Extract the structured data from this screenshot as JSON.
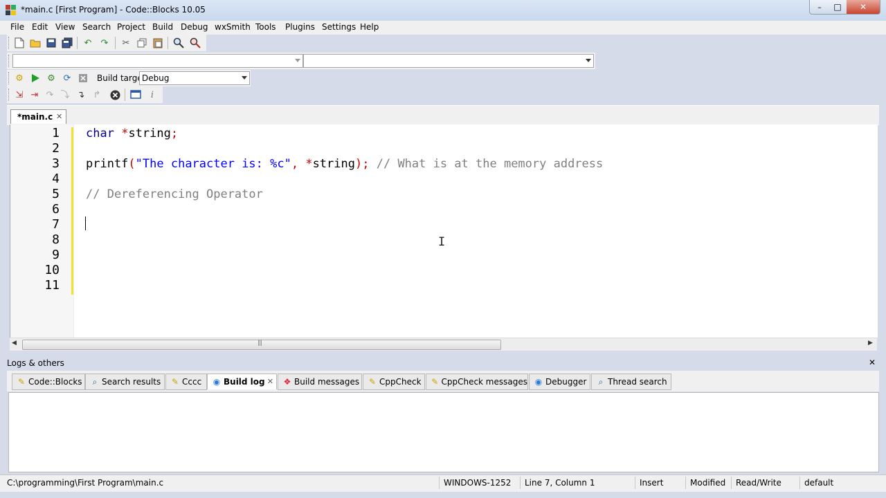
{
  "window": {
    "title": "*main.c [First Program] - Code::Blocks 10.05",
    "minimize_glyph": "–",
    "maximize_glyph": "□",
    "close_glyph": "✕"
  },
  "menu": [
    "File",
    "Edit",
    "View",
    "Search",
    "Project",
    "Build",
    "Debug",
    "wxSmith",
    "Tools",
    "Plugins",
    "Settings",
    "Help"
  ],
  "compiler_toolbar": {
    "build_target_label": "Build target:",
    "build_target_value": "Debug"
  },
  "editor": {
    "tab_label": "*main.c",
    "tab_close": "✕",
    "line_numbers": [
      "1",
      "2",
      "3",
      "4",
      "5",
      "6",
      "7",
      "8",
      "9",
      "10",
      "11"
    ],
    "line1": {
      "kw": "char",
      "sp": " ",
      "op": "*",
      "rest": "string",
      "semi": ";"
    },
    "line3": {
      "fn": "printf",
      "open": "(",
      "str": "\"The character is: %c\"",
      "comma": ", ",
      "op": "*",
      "rest": "string",
      "close": ");",
      "sp": " ",
      "comment": "// What is at the memory address"
    },
    "line5": {
      "comment": "// Dereferencing Operator"
    },
    "cursor_glyph": "I"
  },
  "logs": {
    "header": "Logs & others",
    "close": "✕",
    "tabs": [
      {
        "label": "Code::Blocks",
        "icon": "✎"
      },
      {
        "label": "Search results",
        "icon": "⌕"
      },
      {
        "label": "Cccc",
        "icon": "✎"
      },
      {
        "label": "Build log",
        "icon": "◉",
        "close": "✕"
      },
      {
        "label": "Build messages",
        "icon": "❖"
      },
      {
        "label": "CppCheck",
        "icon": "✎"
      },
      {
        "label": "CppCheck messages",
        "icon": "✎"
      },
      {
        "label": "Debugger",
        "icon": "◉"
      },
      {
        "label": "Thread search",
        "icon": "⌕"
      }
    ]
  },
  "status": {
    "path": "C:\\programming\\First Program\\main.c",
    "encoding": "WINDOWS-1252",
    "position": "Line 7, Column 1",
    "mode": "Insert",
    "modified": "Modified",
    "access": "Read/Write",
    "lang": "default"
  },
  "colors": {
    "keyword": "#00008b",
    "operator": "#cc0000",
    "string": "#0000ff",
    "comment": "#7f7f7f",
    "change_bar": "#f2e22a"
  }
}
